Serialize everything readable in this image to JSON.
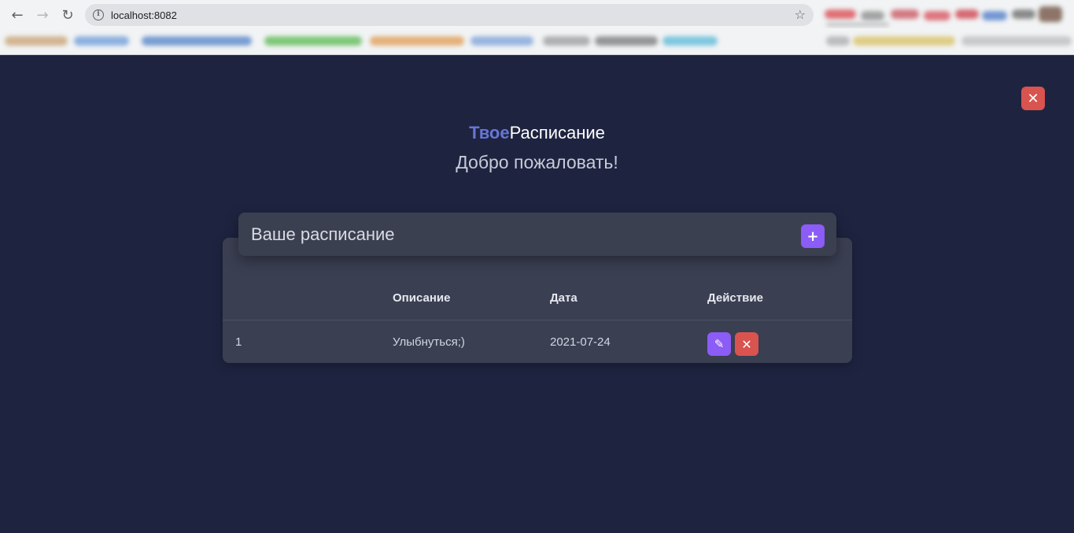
{
  "browser": {
    "url": "localhost:8082",
    "back_icon": "arrow-left-icon",
    "forward_icon": "arrow-right-icon",
    "reload_icon": "reload-icon",
    "info_icon": "info-icon",
    "star_icon": "star-icon"
  },
  "app": {
    "brand_accent": "Твое",
    "brand_rest": "Расписание",
    "welcome": "Добро пожаловать!",
    "close_icon": "close-icon",
    "colors": {
      "background": "#1e2440",
      "card": "#3a3f52",
      "accent_brand": "#6776d4",
      "primary_button": "#8b5cf6",
      "danger_button": "#d9534f"
    }
  },
  "schedule": {
    "title": "Ваше расписание",
    "add_icon": "plus-icon",
    "columns": [
      "",
      "Описание",
      "Дата",
      "Действие"
    ],
    "rows": [
      {
        "index": "1",
        "description": "Улыбнуться;)",
        "date": "2021-07-24",
        "edit_icon": "pencil-icon",
        "delete_icon": "close-icon"
      }
    ]
  }
}
